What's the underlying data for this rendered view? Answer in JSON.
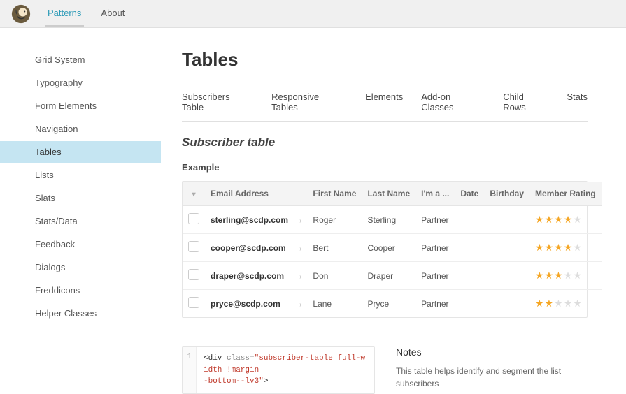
{
  "topnav": {
    "items": [
      "Patterns",
      "About"
    ],
    "active": 0
  },
  "sidebar": {
    "items": [
      "Grid System",
      "Typography",
      "Form Elements",
      "Navigation",
      "Tables",
      "Lists",
      "Slats",
      "Stats/Data",
      "Feedback",
      "Dialogs",
      "Freddicons",
      "Helper Classes"
    ],
    "active": 4
  },
  "page": {
    "title": "Tables"
  },
  "tabs": {
    "items": [
      "Subscribers Table",
      "Responsive Tables",
      "Elements",
      "Add-on Classes",
      "Child Rows",
      "Stats"
    ]
  },
  "section": {
    "title": "Subscriber table",
    "example_label": "Example"
  },
  "table": {
    "headers": [
      "",
      "Email Address",
      "",
      "First Name",
      "Last Name",
      "I'm a ...",
      "Date",
      "Birthday",
      "Member Rating"
    ],
    "rows": [
      {
        "email": "sterling@scdp.com",
        "first": "Roger",
        "last": "Sterling",
        "role": "Partner",
        "date": "",
        "birthday": "",
        "rating": 4
      },
      {
        "email": "cooper@scdp.com",
        "first": "Bert",
        "last": "Cooper",
        "role": "Partner",
        "date": "",
        "birthday": "",
        "rating": 4
      },
      {
        "email": "draper@scdp.com",
        "first": "Don",
        "last": "Draper",
        "role": "Partner",
        "date": "",
        "birthday": "",
        "rating": 3
      },
      {
        "email": "pryce@scdp.com",
        "first": "Lane",
        "last": "Pryce",
        "role": "Partner",
        "date": "",
        "birthday": "",
        "rating": 2
      }
    ]
  },
  "code": {
    "line_number": "1",
    "raw": "<div class=\"subscriber-table full-width !margin-bottom--lv3\">"
  },
  "notes": {
    "title": "Notes",
    "text": "This table helps identify and segment the list subscribers"
  }
}
